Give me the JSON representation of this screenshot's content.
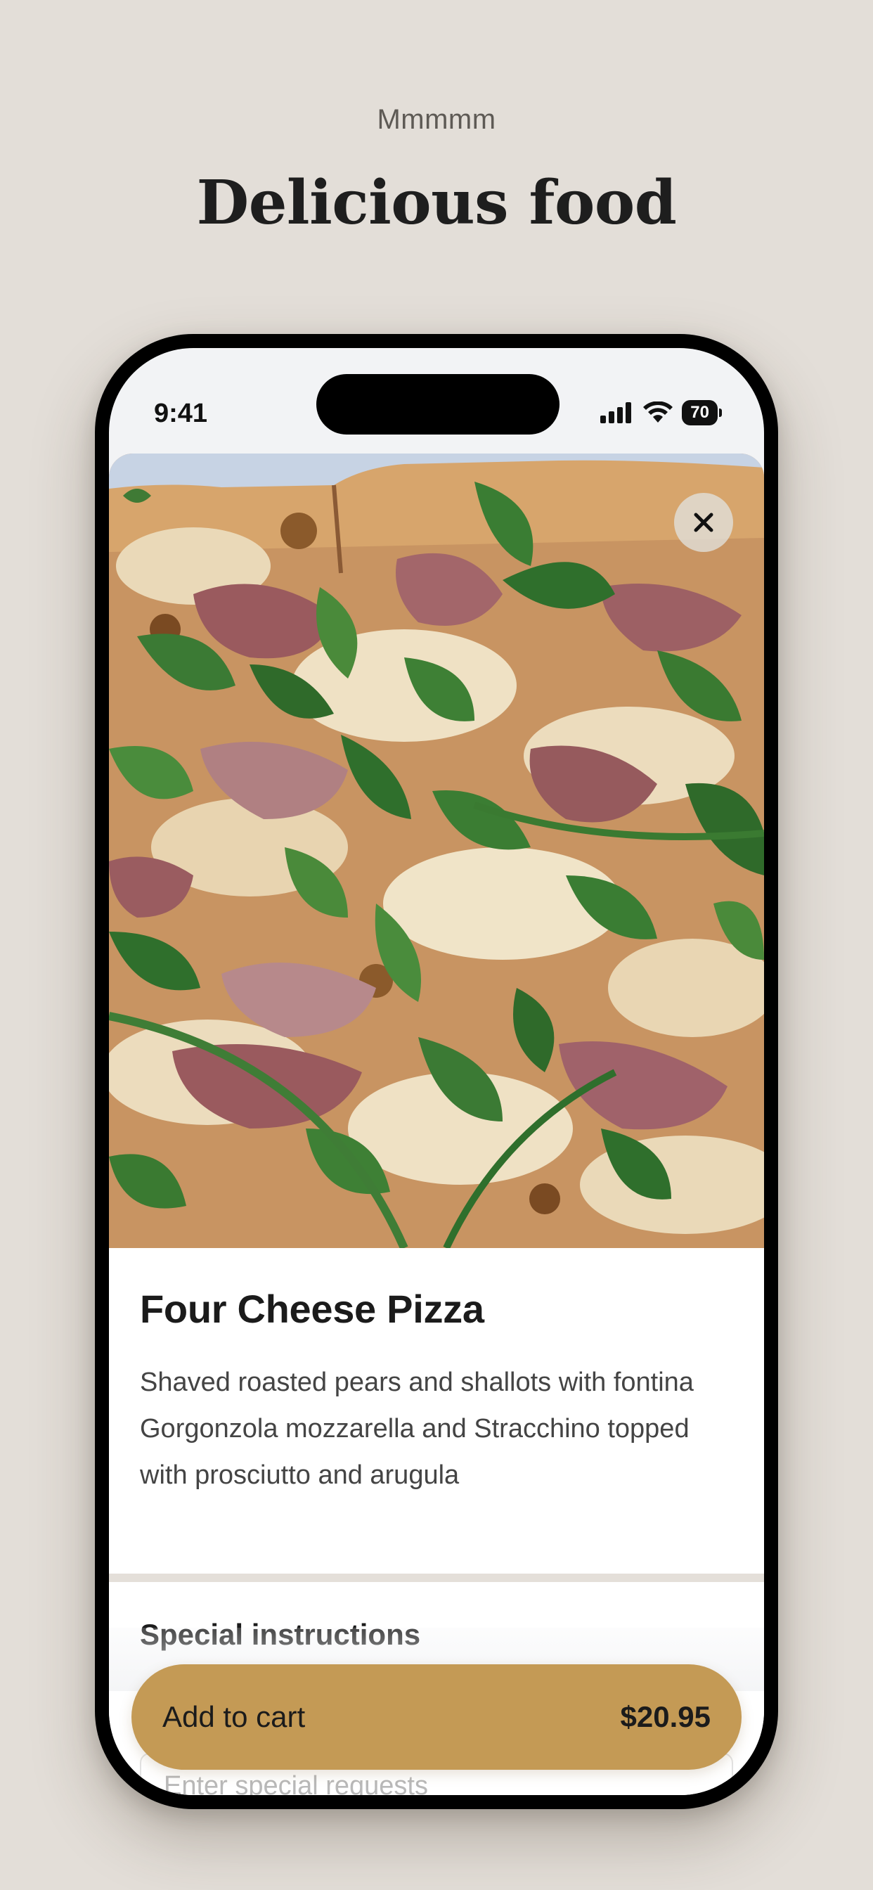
{
  "promo": {
    "eyebrow": "Mmmmm",
    "headline": "Delicious food"
  },
  "status_bar": {
    "time": "9:41",
    "battery": "70"
  },
  "item": {
    "image": "pizza-photo",
    "name": "Four Cheese Pizza",
    "description": "Shaved roasted pears and shallots with fontina Gorgonzola mozzarella and Stracchino topped with prosciutto and arugula"
  },
  "special_instructions": {
    "label": "Special instructions",
    "placeholder": "Enter special requests"
  },
  "cart": {
    "label": "Add to cart",
    "price": "$20.95"
  },
  "icons": {
    "close": "close-icon",
    "signal": "cellular-signal-icon",
    "wifi": "wifi-icon",
    "battery": "battery-icon"
  },
  "colors": {
    "background": "#e3ded8",
    "accent": "#c49a55"
  }
}
